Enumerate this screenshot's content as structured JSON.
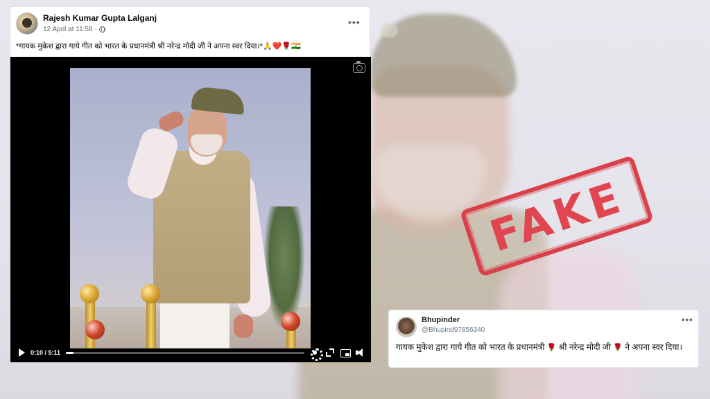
{
  "facebook_post": {
    "author": "Rajesh Kumar Gupta Lalganj",
    "timestamp": "12 April at 11:58",
    "separator": "·",
    "more": "•••",
    "text": "*गायक मुकेश द्वारा गाये गीत को भारत के प्रधानमंत्री श्री नरेन्द्र मोदी जी ने अपना स्वर दिया।*🙏❤️🌹🇮🇳",
    "video": {
      "time": "0:10 / 5:11",
      "progress": 0.032
    }
  },
  "stamp": {
    "text": "FAKE",
    "color": "#d9404a"
  },
  "tweet": {
    "name": "Bhupinder",
    "handle": "@Bhupind97856340",
    "more": "•••",
    "text_part1": "गायक मुकेश द्वारा गाये गीत को भारत के प्रधानमंत्री ",
    "rose": "🌹",
    "text_part2": " श्री नरेन्द्र मोदी जी ",
    "text_part3": " ने अपना स्वर दिया।"
  },
  "colors": {
    "facebook_meta": "#65676b",
    "twitter_handle": "#657786"
  }
}
